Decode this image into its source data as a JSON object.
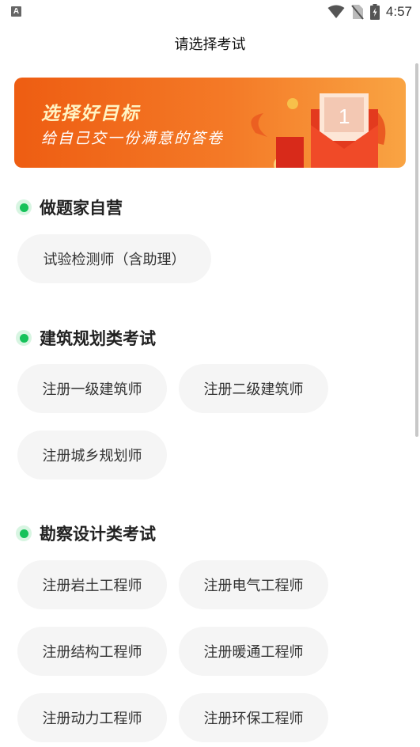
{
  "status": {
    "time": "4:57",
    "notification_letter": "A"
  },
  "header": {
    "title": "请选择考试"
  },
  "banner": {
    "title": "选择好目标",
    "subtitle": "给自己交一份满意的答卷",
    "envelope_number": "1"
  },
  "sections": [
    {
      "title": "做题家自营",
      "items": [
        "试验检测师（含助理）"
      ]
    },
    {
      "title": "建筑规划类考试",
      "items": [
        "注册一级建筑师",
        "注册二级建筑师",
        "注册城乡规划师"
      ]
    },
    {
      "title": "勘察设计类考试",
      "items": [
        "注册岩土工程师",
        "注册电气工程师",
        "注册结构工程师",
        "注册暖通工程师",
        "注册动力工程师",
        "注册环保工程师"
      ]
    }
  ],
  "colors": {
    "accent": "#16c25a",
    "banner_start": "#ee5d12",
    "banner_end": "#f9a443",
    "chip_bg": "#f5f5f5"
  }
}
